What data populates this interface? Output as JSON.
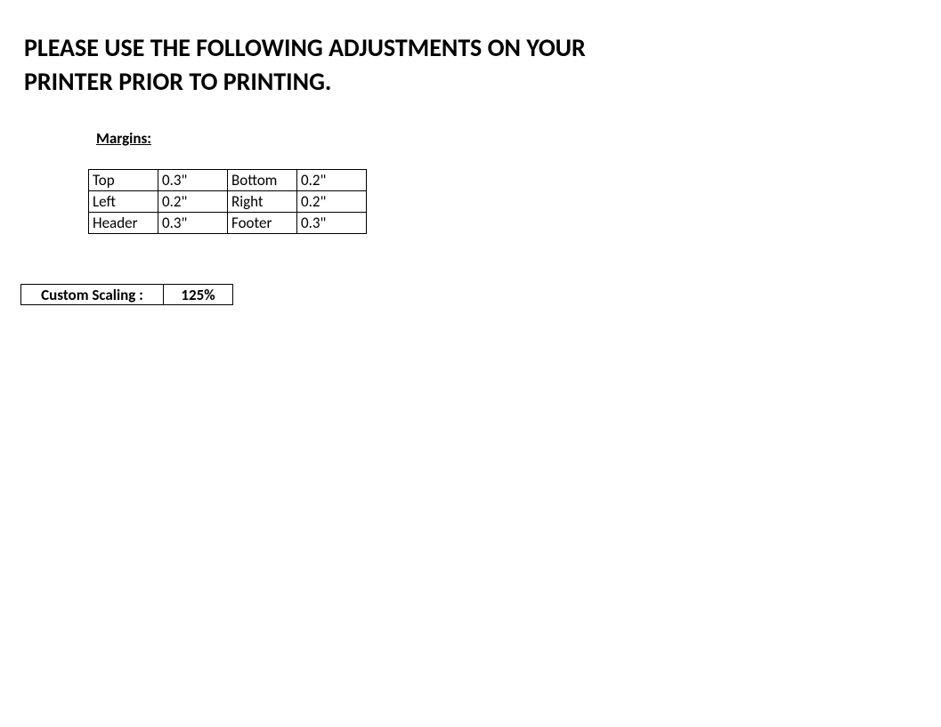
{
  "title_line1": "PLEASE USE THE FOLLOWING ADJUSTMENTS ON YOUR",
  "title_line2": " PRINTER PRIOR TO PRINTING.",
  "margins": {
    "label": "Margins:",
    "rows": [
      {
        "left_label": "Top",
        "left_value": "0.3\"",
        "right_label": "Bottom",
        "right_value": "0.2\""
      },
      {
        "left_label": "Left",
        "left_value": "0.2\"",
        "right_label": "Right",
        "right_value": "0.2\""
      },
      {
        "left_label": "Header",
        "left_value": "0.3\"",
        "right_label": "Footer",
        "right_value": "0.3\""
      }
    ]
  },
  "scaling": {
    "label": "Custom Scaling :",
    "value": "125%"
  }
}
